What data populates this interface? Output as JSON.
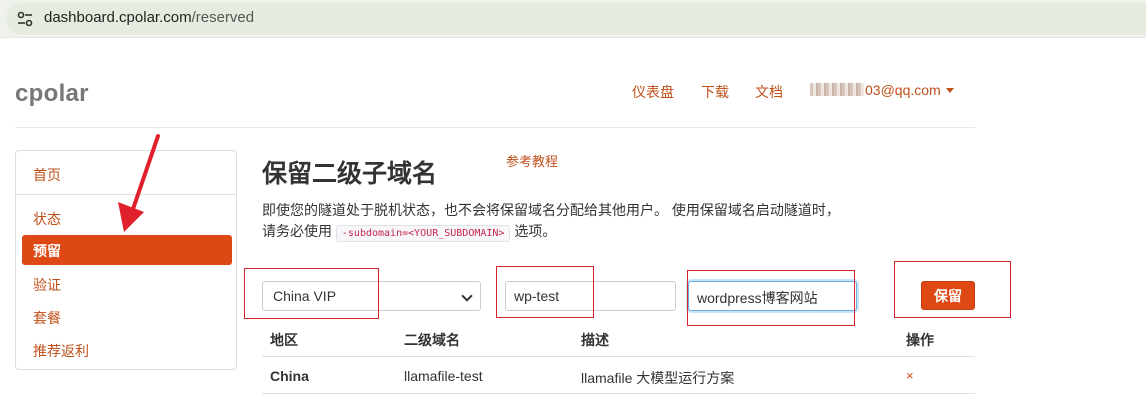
{
  "browser": {
    "url_host": "dashboard.cpolar.com",
    "url_path": "/reserved"
  },
  "header": {
    "brand": "cpolar",
    "nav": [
      "仪表盘",
      "下载",
      "文档"
    ],
    "account_visible": "03@qq.com"
  },
  "sidebar": {
    "items": [
      {
        "label": "首页",
        "active": false
      },
      {
        "label": "状态",
        "active": false
      },
      {
        "label": "预留",
        "active": true
      },
      {
        "label": "验证",
        "active": false
      },
      {
        "label": "套餐",
        "active": false
      },
      {
        "label": "推荐返利",
        "active": false
      }
    ]
  },
  "main": {
    "title": "保留二级子域名",
    "tutorial_link": "参考教程",
    "description_1": "即使您的隧道处于脱机状态，也不会将保留域名分配给其他用户。 使用保留域名启动隧道时，请务必使用",
    "description_code": "-subdomain=<YOUR_SUBDOMAIN>",
    "description_2": "选项。",
    "form": {
      "region_selected": "China VIP",
      "subdomain_value": "wp-test",
      "description_value": "wordpress博客网站",
      "save_label": "保留"
    },
    "table": {
      "headers": [
        "地区",
        "二级域名",
        "描述",
        "操作"
      ],
      "rows": [
        {
          "region": "China",
          "subdomain": "llamafile-test",
          "description": "llamafile 大模型运行方案",
          "action": "×"
        }
      ]
    }
  },
  "colors": {
    "accent": "#dd4814",
    "link": "#c0501a",
    "annotation_red": "#d6242a"
  }
}
